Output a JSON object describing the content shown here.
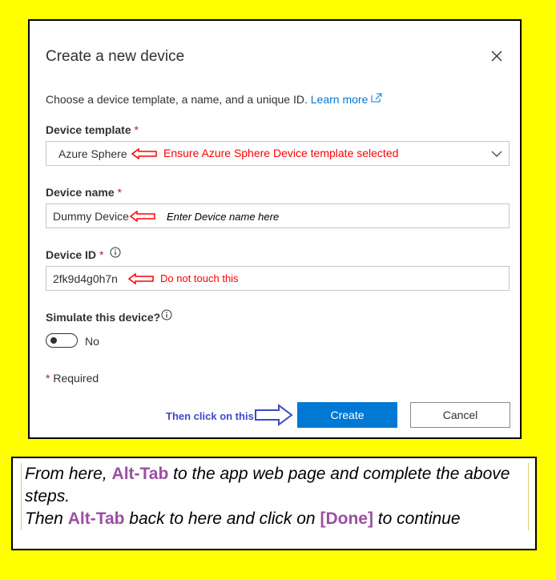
{
  "dialog": {
    "title": "Create a new device",
    "subtitle": "Choose a device template, a name, and a unique ID.",
    "learn_more": "Learn more",
    "template_label": "Device template",
    "template_value": "Azure Sphere",
    "name_label": "Device name",
    "name_value": "Dummy Device",
    "id_label": "Device ID",
    "id_value": "2fk9d4g0h7n",
    "simulate_label": "Simulate this device?",
    "toggle_state": "No",
    "required_star": "*",
    "required_note": "Required",
    "create_label": "Create",
    "cancel_label": "Cancel"
  },
  "annotations": {
    "template_note": "Ensure Azure Sphere Device template selected",
    "name_note": "Enter Device name here",
    "id_note": "Do not touch this",
    "click_note": "Then click on this"
  },
  "instructions": {
    "line1_a": "From here, ",
    "line1_hl": "Alt-Tab",
    "line1_b": " to the app web page and complete the above steps.",
    "line2_a": "Then ",
    "line2_hl": "Alt-Tab",
    "line2_b": " back to here and click on ",
    "line2_hl2": "[Done]",
    "line2_c": " to continue"
  },
  "colors": {
    "background": "#ffff00",
    "primary_button": "#0078d4",
    "annotation_red": "#ff0000",
    "annotation_blue": "#3f48cc",
    "highlight_purple": "#9b4fa0"
  },
  "icons": [
    "close-icon",
    "external-link-icon",
    "chevron-down-icon",
    "info-icon",
    "arrow-left-icon",
    "arrow-right-icon"
  ]
}
